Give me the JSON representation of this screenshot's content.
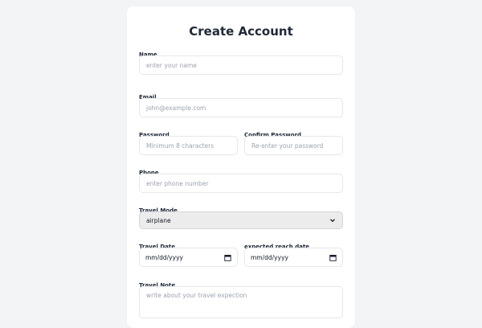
{
  "form": {
    "title": "Create Account",
    "name": {
      "label": "Name",
      "placeholder": "enter your name"
    },
    "email": {
      "label": "Email",
      "placeholder": "john@example.com"
    },
    "password": {
      "label": "Password",
      "placeholder": "Minimum 8 characters"
    },
    "confirm_password": {
      "label": "Confirm Password",
      "placeholder": "Re-enter your password"
    },
    "phone": {
      "label": "Phone",
      "placeholder": "enter phone number"
    },
    "travel_mode": {
      "label": "Travel Mode",
      "value": "airplane"
    },
    "travel_date": {
      "label": "Travel Date",
      "value": "mm/dd/yyyy"
    },
    "reach_date": {
      "label": "expected reach date",
      "value": "mm/dd/yyyy"
    },
    "travel_note": {
      "label": "Travel Note",
      "placeholder": "write about your travel expection"
    }
  },
  "icons": {
    "select": "chevron-down-icon",
    "date": "calendar-icon"
  }
}
